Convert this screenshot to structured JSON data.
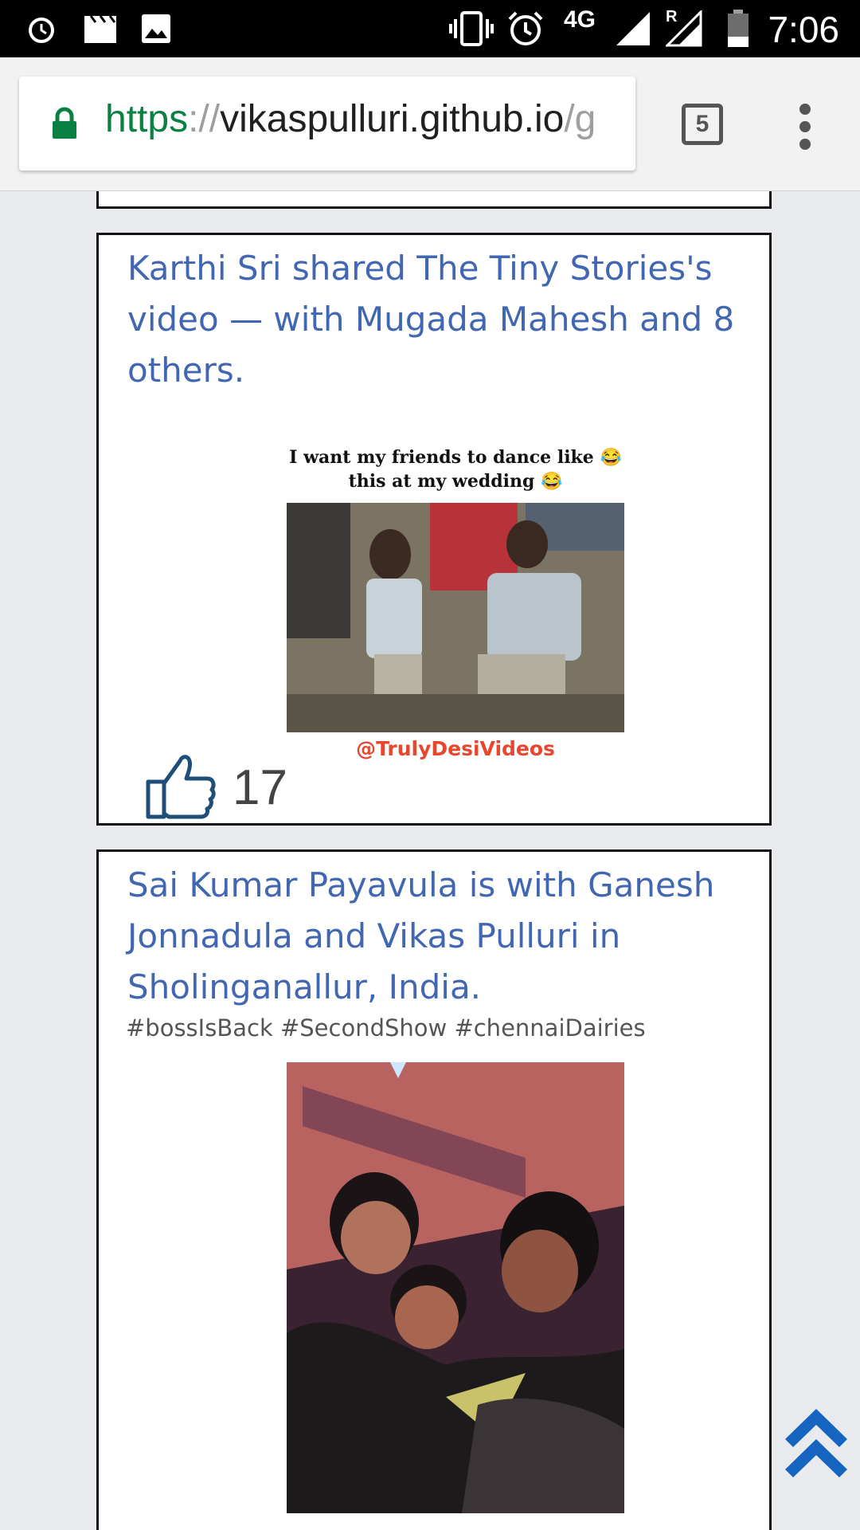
{
  "status_bar": {
    "time": "7:06",
    "network": "4G",
    "roaming": "R",
    "icons": [
      "alarm-icon",
      "clapperboard-icon",
      "image-icon",
      "vibrate-icon",
      "alarm-clock-icon",
      "signal-icon",
      "roaming-signal-icon",
      "battery-icon"
    ]
  },
  "browser": {
    "url_scheme": "https",
    "url_sep": "://",
    "url_host": "vikaspulluri.github.io",
    "url_path": "/g",
    "tab_count": "5"
  },
  "posts": [
    {
      "title": "Karthi Sri shared The Tiny Stories's video — with Mugada Mahesh and 8 others.",
      "image_caption_top": "I want my friends to dance like 😂 this at my wedding 😂",
      "image_credit": "@TrulyDesiVideos",
      "likes": "17"
    },
    {
      "title": "Sai Kumar Payavula is with Ganesh Jonnadula and Vikas Pulluri in Sholinganallur, India.",
      "caption": "#bossIsBack #SecondShow #chennaiDairies"
    }
  ],
  "colors": {
    "title_blue": "#4267b2",
    "like_icon": "#1f4e79",
    "back_to_top": "#1565c0"
  }
}
